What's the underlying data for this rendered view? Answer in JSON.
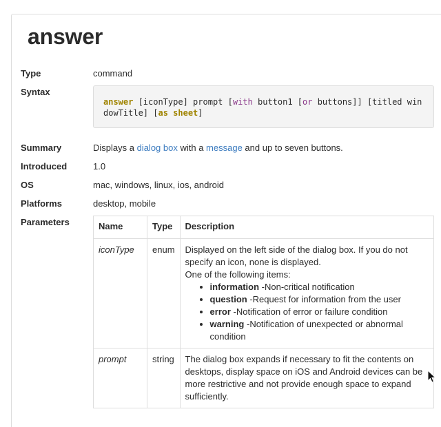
{
  "title": "answer",
  "fields": {
    "type": {
      "label": "Type",
      "value": "command"
    },
    "syntax": {
      "label": "Syntax",
      "parts": [
        {
          "text": "answer",
          "style": "cmd"
        },
        {
          "text": " [iconType] prompt [",
          "style": "plain"
        },
        {
          "text": "with",
          "style": "kw"
        },
        {
          "text": " button1 [",
          "style": "plain"
        },
        {
          "text": "or",
          "style": "kw"
        },
        {
          "text": " buttons]] [titled windowTitle] [",
          "style": "plain"
        },
        {
          "text": "as sheet",
          "style": "olive"
        },
        {
          "text": "]",
          "style": "plain"
        }
      ]
    },
    "summary": {
      "label": "Summary",
      "prefix": "Displays a ",
      "link1": "dialog box",
      "middle": " with a ",
      "link2": "message",
      "suffix": " and up to seven buttons."
    },
    "introduced": {
      "label": "Introduced",
      "value": "1.0"
    },
    "os": {
      "label": "OS",
      "value": "mac, windows, linux, ios, android"
    },
    "platforms": {
      "label": "Platforms",
      "value": "desktop, mobile"
    },
    "parameters": {
      "label": "Parameters"
    }
  },
  "parameters_table": {
    "headers": {
      "name": "Name",
      "type": "Type",
      "description": "Description"
    },
    "rows": [
      {
        "name": "iconType",
        "type": "enum",
        "description": "Displayed on the left side of the dialog box. If you do not specify an icon, none is displayed.",
        "items_intro": "One of the following items:",
        "items": [
          {
            "term": "information",
            "text": " -Non-critical notification"
          },
          {
            "term": "question",
            "text": " -Request for information from the user"
          },
          {
            "term": "error",
            "text": " -Notification of error or failure condition"
          },
          {
            "term": "warning",
            "text": " -Notification of unexpected or abnormal condition"
          }
        ]
      },
      {
        "name": "prompt",
        "type": "string",
        "description": "The dialog box expands if necessary to fit the contents on desktops, display space on iOS and Android devices can be more restrictive and not provide enough space to expand sufficiently."
      }
    ]
  },
  "colors": {
    "link": "#3b7bbf",
    "keyword": "#8b3a8b",
    "command": "#a08400",
    "border": "#dddddd",
    "code_bg": "#f4f4f4"
  },
  "icons": {
    "cursor": "mouse-pointer-icon"
  }
}
